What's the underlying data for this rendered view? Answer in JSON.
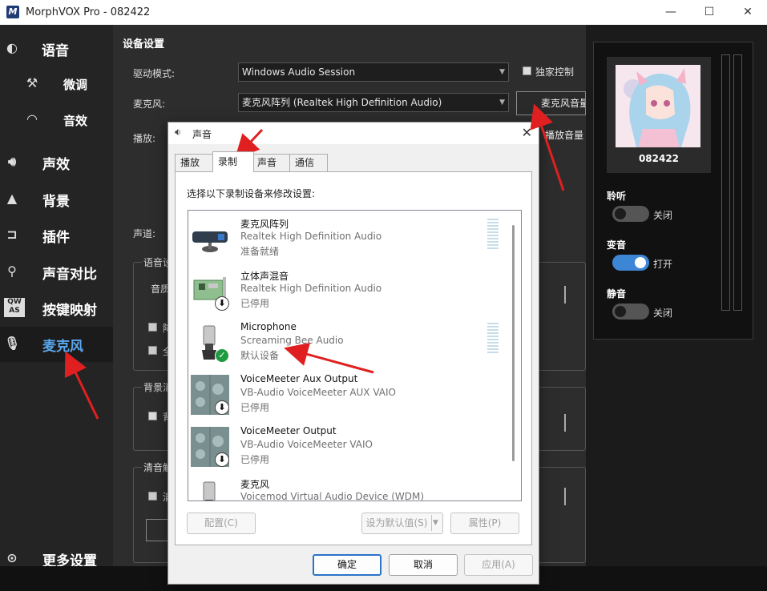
{
  "window": {
    "title": "MorphVOX Pro - 082422",
    "app_icon": "M"
  },
  "sidebar": {
    "items": [
      {
        "label": "语音",
        "icon": "voice-icon"
      },
      {
        "label": "微调",
        "icon": "tweak-icon"
      },
      {
        "label": "音效",
        "icon": "lips-icon"
      },
      {
        "label": "声效",
        "icon": "speaker-icon"
      },
      {
        "label": "背景",
        "icon": "mountain-icon"
      },
      {
        "label": "插件",
        "icon": "plugin-icon"
      },
      {
        "label": "声音对比",
        "icon": "magnifier-icon"
      },
      {
        "label": "按键映射",
        "icon": "keyboard-icon"
      },
      {
        "label": "麦克风",
        "icon": "microphone-icon",
        "active": true
      },
      {
        "label": "更多设置",
        "icon": "more-icon"
      }
    ]
  },
  "main": {
    "heading": "设备设置",
    "driver_label": "驱动模式:",
    "driver_value": "Windows Audio Session",
    "exclusive_label": "独家控制",
    "mic_label": "麦克风:",
    "mic_value": "麦克风阵列 (Realtek High Definition Audio)",
    "mic_button": "麦克风音量",
    "playback_label": "播放:",
    "playback_button": "播放音量",
    "channel_label": "声道:",
    "group1_title": "语音设",
    "group1_text": "音质",
    "group1_chk1": "降",
    "group1_chk2": "全",
    "group2_title": "背景消",
    "group2_chk": "背",
    "group3_title": "清音解",
    "group3_chk": "清"
  },
  "right": {
    "username": "082422",
    "listen": {
      "label": "聆听",
      "state": "关闭",
      "on": false
    },
    "voice_change": {
      "label": "变音",
      "state": "打开",
      "on": true
    },
    "mute": {
      "label": "静音",
      "state": "关闭",
      "on": false
    }
  },
  "dialog": {
    "title": "声音",
    "close": "✕",
    "tabs": [
      "播放",
      "录制",
      "声音",
      "通信"
    ],
    "active_tab": "录制",
    "instruction": "选择以下录制设备来修改设置:",
    "devices": [
      {
        "name": "麦克风阵列",
        "desc": "Realtek High Definition Audio",
        "status": "准备就绪",
        "icon": "mic-array-icon",
        "badge": "",
        "level": true
      },
      {
        "name": "立体声混音",
        "desc": "Realtek High Definition Audio",
        "status": "已停用",
        "icon": "sound-card-icon",
        "badge": "down",
        "level": false
      },
      {
        "name": "Microphone",
        "desc": "Screaming Bee Audio",
        "status": "默认设备",
        "icon": "microphone-device-icon",
        "badge": "ok",
        "level": true
      },
      {
        "name": "VoiceMeeter Aux Output",
        "desc": "VB-Audio VoiceMeeter AUX VAIO",
        "status": "已停用",
        "icon": "voicemeeter-icon",
        "badge": "down",
        "level": false
      },
      {
        "name": "VoiceMeeter Output",
        "desc": "VB-Audio VoiceMeeter VAIO",
        "status": "已停用",
        "icon": "voicemeeter-icon",
        "badge": "down",
        "level": false
      },
      {
        "name": "麦克风",
        "desc": "Voicemod Virtual Audio Device (WDM)",
        "status": "",
        "icon": "microphone-device-icon",
        "badge": "",
        "level": false
      }
    ],
    "buttons": {
      "configure": "配置(C)",
      "set_default": "设为默认值(S)",
      "properties": "属性(P)",
      "ok": "确定",
      "cancel": "取消",
      "apply": "应用(A)"
    }
  },
  "colors": {
    "accent": "#5aa8f0",
    "annotation_arrow": "#e02020",
    "toggle_on": "#3d86d6",
    "default_ok": "#1e9b3f"
  }
}
